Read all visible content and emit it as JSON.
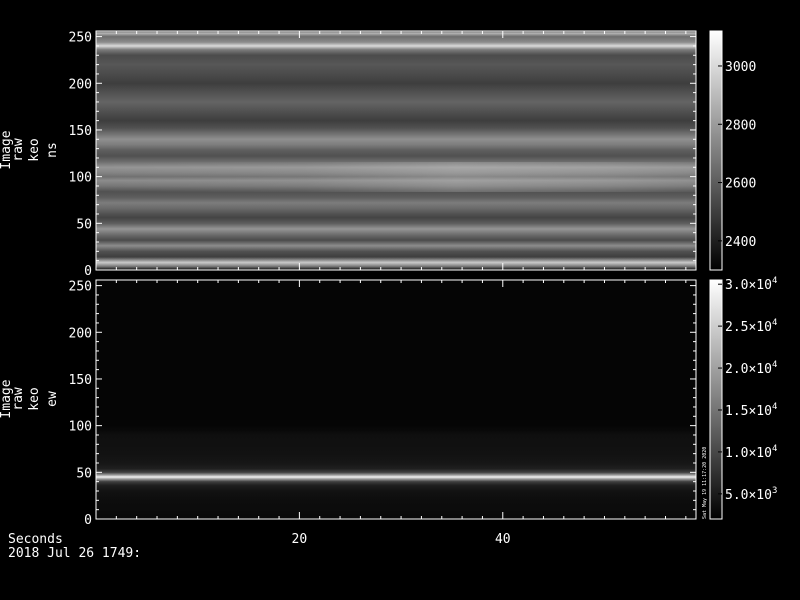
{
  "chart_data": [
    {
      "type": "heatmap",
      "ylabel_lines": [
        "Image",
        "raw",
        "keo",
        "ns"
      ],
      "xlim": [
        0,
        59
      ],
      "ylim": [
        0,
        256
      ],
      "yticks": [
        0,
        50,
        100,
        150,
        200,
        250
      ],
      "xticks": [
        20,
        40
      ],
      "colorbar": {
        "range": [
          2300,
          3120
        ],
        "ticks": [
          2400,
          2600,
          2800,
          3000
        ],
        "tick_labels": [
          "2400",
          "2600",
          "2800",
          "3000"
        ],
        "colormap": "grayscale"
      },
      "profile": [
        [
          0,
          2330
        ],
        [
          4,
          2700
        ],
        [
          8,
          2950
        ],
        [
          14,
          2500
        ],
        [
          20,
          2560
        ],
        [
          26,
          2750
        ],
        [
          32,
          2540
        ],
        [
          38,
          2650
        ],
        [
          44,
          2780
        ],
        [
          50,
          2600
        ],
        [
          56,
          2520
        ],
        [
          60,
          2560
        ],
        [
          66,
          2640
        ],
        [
          72,
          2700
        ],
        [
          78,
          2600
        ],
        [
          84,
          2560
        ],
        [
          90,
          2680
        ],
        [
          96,
          2750
        ],
        [
          100,
          2660
        ],
        [
          104,
          2720
        ],
        [
          110,
          2780
        ],
        [
          116,
          2650
        ],
        [
          122,
          2560
        ],
        [
          128,
          2600
        ],
        [
          134,
          2700
        ],
        [
          140,
          2760
        ],
        [
          146,
          2660
        ],
        [
          152,
          2560
        ],
        [
          160,
          2500
        ],
        [
          170,
          2560
        ],
        [
          180,
          2620
        ],
        [
          190,
          2560
        ],
        [
          200,
          2500
        ],
        [
          210,
          2540
        ],
        [
          220,
          2580
        ],
        [
          230,
          2540
        ],
        [
          236,
          2700
        ],
        [
          240,
          3000
        ],
        [
          244,
          2750
        ],
        [
          250,
          2650
        ],
        [
          254,
          2900
        ],
        [
          256,
          2350
        ]
      ]
    },
    {
      "type": "heatmap",
      "ylabel_lines": [
        "Image",
        "raw",
        "keo",
        "ew"
      ],
      "xlim": [
        0,
        59
      ],
      "ylim": [
        0,
        256
      ],
      "yticks": [
        0,
        50,
        100,
        150,
        200,
        250
      ],
      "xticks": [
        20,
        40
      ],
      "colorbar": {
        "range": [
          2000,
          30500
        ],
        "ticks": [
          5000,
          10000,
          15000,
          20000,
          25000,
          30000
        ],
        "tick_labels": [
          {
            "m": "5.0×10",
            "e": "3"
          },
          {
            "m": "1.0×10",
            "e": "4"
          },
          {
            "m": "1.5×10",
            "e": "4"
          },
          {
            "m": "2.0×10",
            "e": "4"
          },
          {
            "m": "2.5×10",
            "e": "4"
          },
          {
            "m": "3.0×10",
            "e": "4"
          }
        ],
        "colormap": "grayscale"
      },
      "profile": [
        [
          0,
          3000
        ],
        [
          10,
          3300
        ],
        [
          20,
          3500
        ],
        [
          30,
          4000
        ],
        [
          36,
          5500
        ],
        [
          40,
          9000
        ],
        [
          43,
          20000
        ],
        [
          45,
          29000
        ],
        [
          47,
          20000
        ],
        [
          50,
          9000
        ],
        [
          54,
          5500
        ],
        [
          60,
          4500
        ],
        [
          70,
          4000
        ],
        [
          80,
          3800
        ],
        [
          90,
          3700
        ],
        [
          95,
          3000
        ],
        [
          100,
          2600
        ],
        [
          256,
          2600
        ]
      ]
    }
  ],
  "footer": {
    "xlabel": "Seconds",
    "date": "2018 Jul 26 1749:",
    "stamp": "Sat May 19 11:17:20 2020"
  }
}
